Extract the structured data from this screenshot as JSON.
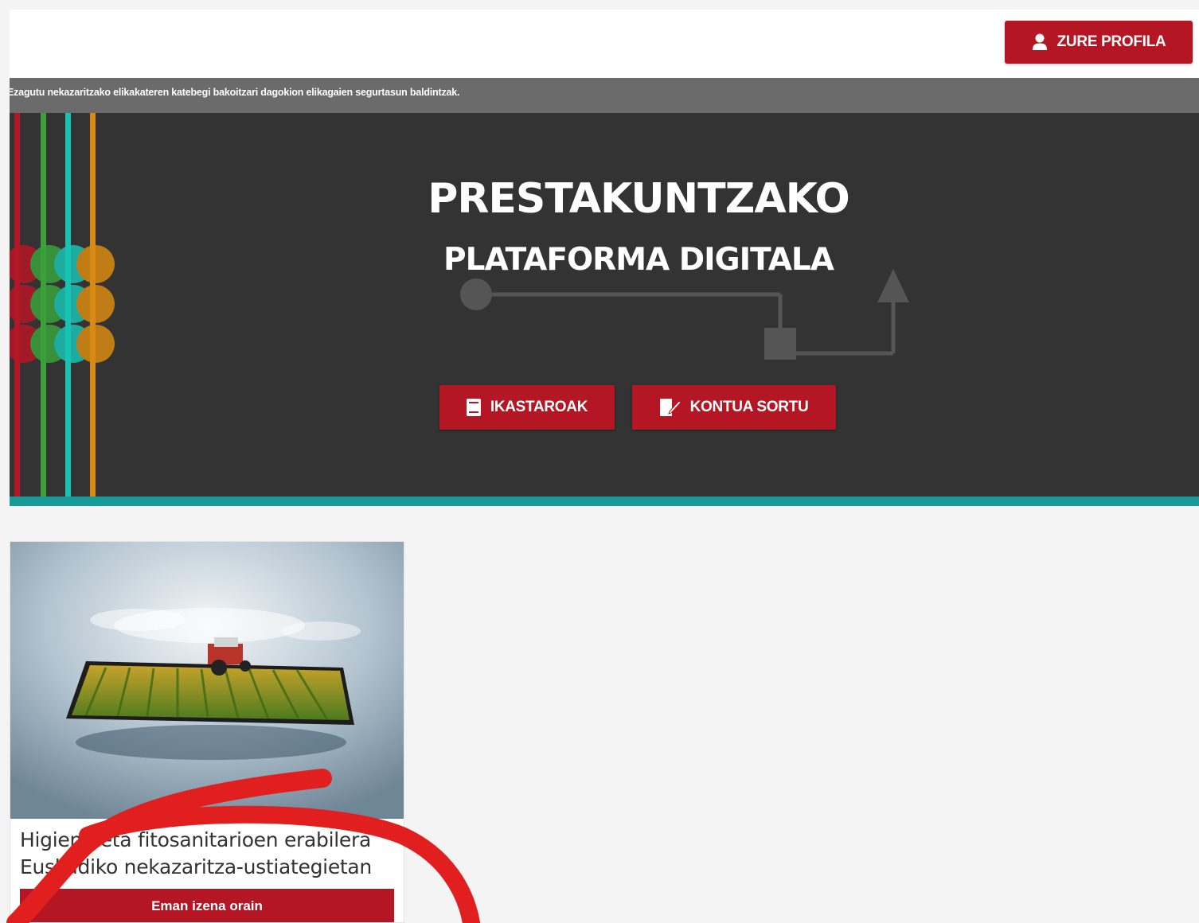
{
  "header": {
    "profile_button_label": "ZURE PROFILA",
    "profile_icon": "user-icon"
  },
  "subtitle_bar": {
    "text": "Ezagutu nekazaritzako elikakateren katebegi bakoitzari dagokion elikagaien segurtasun baldintzak."
  },
  "hero": {
    "title": "PRESTAKUNTZAKO",
    "subtitle": "PLATAFORMA DIGITALA",
    "buttons": [
      {
        "label": "IKASTAROAK",
        "icon": "book-icon"
      },
      {
        "label": "KONTUA SORTU",
        "icon": "edit-document-icon"
      }
    ],
    "stripe_colors": [
      "#b51623",
      "#3aa13a",
      "#19c3b3",
      "#d98a12"
    ]
  },
  "course_card": {
    "title": "Higiene eta fitosanitarioen erabilera Euskadiko nekazaritza-ustiategietan",
    "button_label": "Eman izena orain"
  },
  "colors": {
    "brand_red": "#b51623",
    "teal": "#179a98",
    "hero_bg": "#333333",
    "annotation_red": "#e21f1f"
  }
}
